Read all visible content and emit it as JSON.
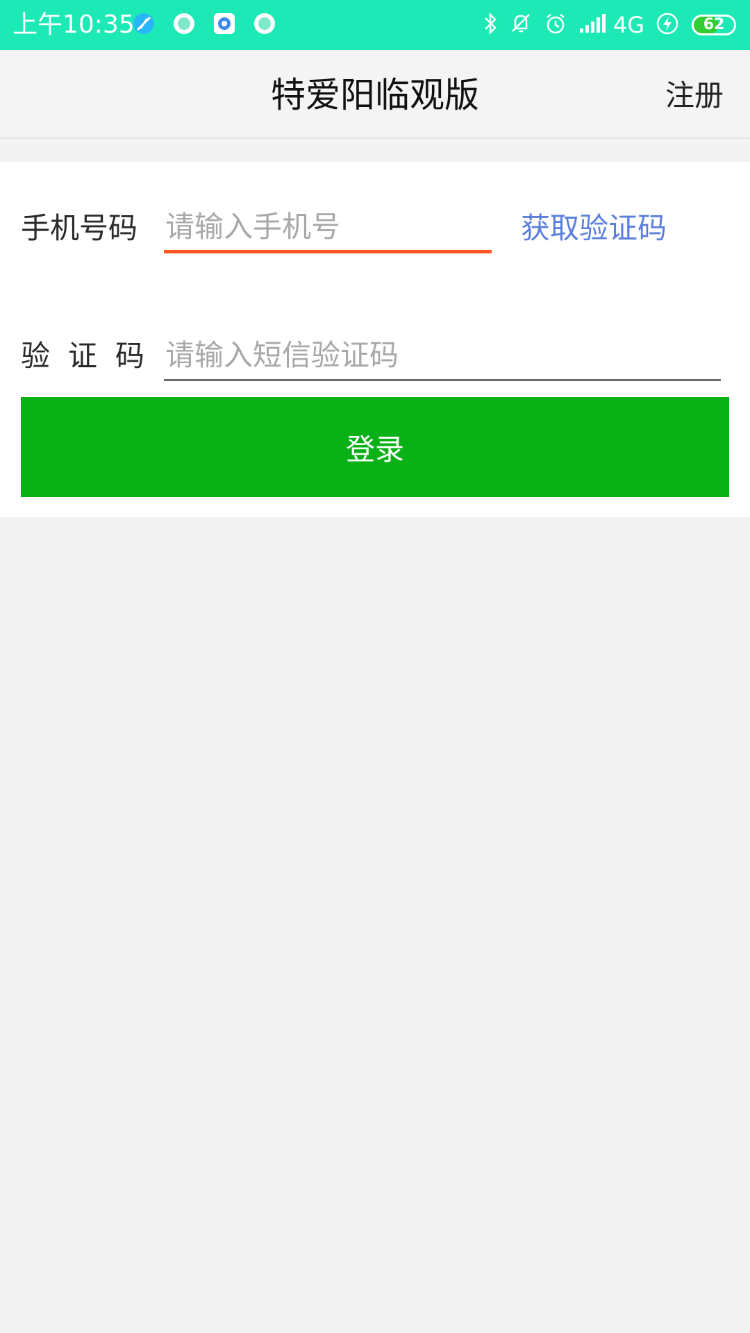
{
  "status_bar": {
    "time": "上午10:35",
    "network": "4G",
    "battery_level": 62,
    "battery_text": "62",
    "icons": [
      "feather-app-icon",
      "circle-app-icon",
      "qq-browser-icon",
      "circle-app-icon",
      "bluetooth-icon",
      "vibrate-off-icon",
      "alarm-icon",
      "signal-icon",
      "charging-icon",
      "battery-icon"
    ],
    "accent": "#1de9b6"
  },
  "header": {
    "title": "特爱阳临观版",
    "register_label": "注册"
  },
  "form": {
    "phone_label": "手机号码",
    "phone_placeholder": "请输入手机号",
    "phone_value": "",
    "get_code_label": "获取验证码",
    "code_label": "验证码",
    "code_placeholder": "请输入短信验证码",
    "code_value": "",
    "login_label": "登录"
  },
  "colors": {
    "login_button": "#09b117",
    "active_underline": "#ff5722",
    "link": "#5b7fdc"
  }
}
